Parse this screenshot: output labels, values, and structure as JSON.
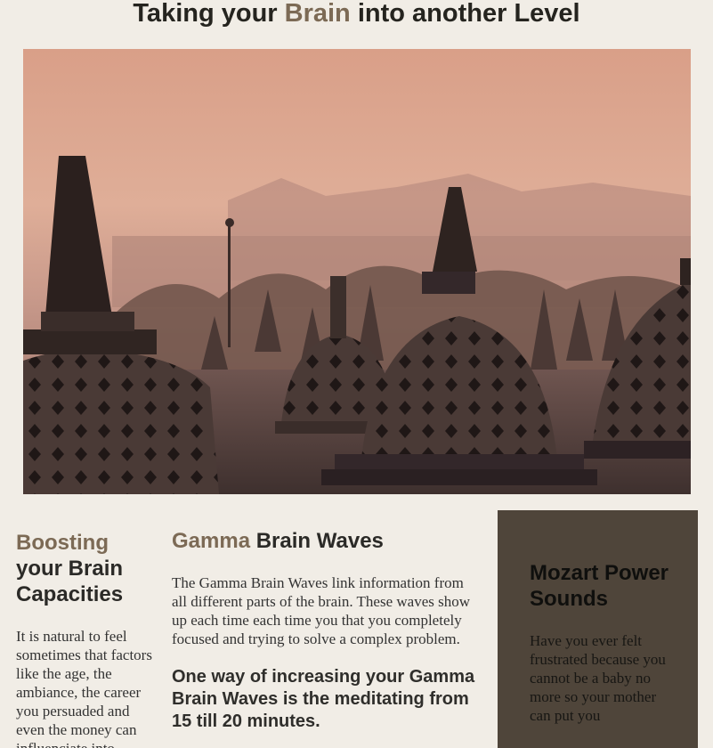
{
  "header": {
    "title_before": "Taking your ",
    "title_accent": "Brain",
    "title_after": " into another Level"
  },
  "hero": {
    "alt": "misty temple stupas at sunrise"
  },
  "left": {
    "heading_accent": "Boosting",
    "heading_rest": " your Brain Capacities",
    "body": "It is natural to feel sometimes that factors like the age, the ambiance, the career you persuaded and even the money can influenciate into"
  },
  "middle": {
    "heading_accent": "Gamma",
    "heading_rest": " Brain Waves",
    "body": "The Gamma Brain Waves link information from all different parts of the brain. These waves show up each time each time you that you completely focused and trying to solve a complex problem.",
    "subheading": "One way of increasing your Gamma Brain Waves is the meditating from 15 till 20 minutes."
  },
  "right": {
    "heading": "Mozart Power Sounds",
    "body": "Have you ever felt frustrated because you cannot be a baby no more so your mother can put you"
  },
  "colors": {
    "background": "#f1ede6",
    "accent": "#7c6a55",
    "panel": "#4f453a"
  }
}
